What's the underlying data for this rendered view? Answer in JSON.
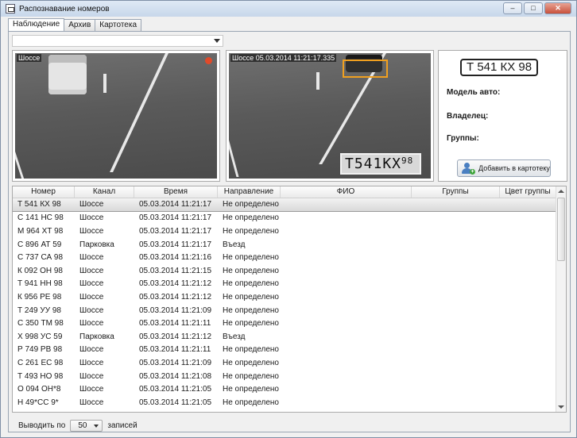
{
  "window": {
    "title": "Распознавание номеров",
    "minimize_label": "–",
    "maximize_label": "□",
    "close_label": "✕"
  },
  "tabs": [
    "Наблюдение",
    "Архив",
    "Картотека"
  ],
  "cameras": [
    {
      "label": "Шоссе"
    },
    {
      "label": "Шоссе   05.03.2014 11:21:17.335",
      "plate_main": "T541KX",
      "plate_region": "98"
    }
  ],
  "info": {
    "plate": "Т 541 КХ 98",
    "model_label": "Модель авто:",
    "owner_label": "Владелец:",
    "groups_label": "Группы:",
    "add_button": "Добавить в картотеку"
  },
  "table": {
    "columns": [
      "Номер",
      "Канал",
      "Время",
      "Направление",
      "ФИО",
      "Группы",
      "Цвет группы"
    ],
    "rows": [
      [
        "Т 541 КХ 98",
        "Шоссе",
        "05.03.2014 11:21:17",
        "Не определено"
      ],
      [
        "С 141 НС 98",
        "Шоссе",
        "05.03.2014 11:21:17",
        "Не определено"
      ],
      [
        "М 964 ХТ 98",
        "Шоссе",
        "05.03.2014 11:21:17",
        "Не определено"
      ],
      [
        "С 896 АТ 59",
        "Парковка",
        "05.03.2014 11:21:17",
        "Въезд"
      ],
      [
        "С 737 СА 98",
        "Шоссе",
        "05.03.2014 11:21:16",
        "Не определено"
      ],
      [
        "К 092 ОН 98",
        "Шоссе",
        "05.03.2014 11:21:15",
        "Не определено"
      ],
      [
        "Т 941 НН 98",
        "Шоссе",
        "05.03.2014 11:21:12",
        "Не определено"
      ],
      [
        "К 956 РЕ 98",
        "Шоссе",
        "05.03.2014 11:21:12",
        "Не определено"
      ],
      [
        "Т 249 УУ 98",
        "Шоссе",
        "05.03.2014 11:21:09",
        "Не определено"
      ],
      [
        "С 350 ТМ 98",
        "Шоссе",
        "05.03.2014 11:21:11",
        "Не определено"
      ],
      [
        "Х 998 УС 59",
        "Парковка",
        "05.03.2014 11:21:12",
        "Въезд"
      ],
      [
        "Р 749 РВ 98",
        "Шоссе",
        "05.03.2014 11:21:11",
        "Не определено"
      ],
      [
        "С 261 ЕС 98",
        "Шоссе",
        "05.03.2014 11:21:09",
        "Не определено"
      ],
      [
        "Т 493 НО 98",
        "Шоссе",
        "05.03.2014 11:21:08",
        "Не определено"
      ],
      [
        "О 094 ОН*8",
        "Шоссе",
        "05.03.2014 11:21:05",
        "Не определено"
      ],
      [
        "Н 49*СС 9*",
        "Шоссе",
        "05.03.2014 11:21:05",
        "Не определено"
      ]
    ]
  },
  "footer": {
    "prefix": "Выводить по",
    "page_size": "50",
    "suffix": "записей"
  },
  "colors": {
    "accent": "#f0a020",
    "record": "#e04a2a"
  }
}
